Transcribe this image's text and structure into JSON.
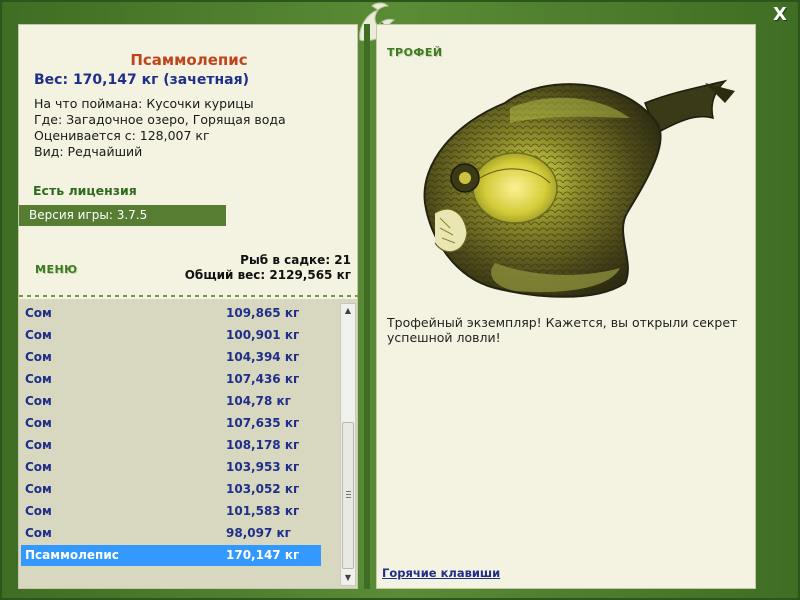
{
  "close_label": "X",
  "left": {
    "fish_name": "Псаммолепис",
    "weight": "Вес: 170,147 кг (зачетная)",
    "caught_on": "На что поймана: Кусочки курицы",
    "location": "Где: Загадочное озеро, Горящая вода",
    "valued_from": "Оценивается с: 128,007 кг",
    "kind": "Вид: Редчайший",
    "license": "Есть лицензия",
    "version": "Версия игры: 3.7.5",
    "menu_label": "МЕНЮ",
    "fish_in_keepnet": "Рыб в садке: 21",
    "total_weight": "Общий вес: 2129,565 кг"
  },
  "list": {
    "items": [
      {
        "name": "Сом",
        "weight": "109,865 кг"
      },
      {
        "name": "Сом",
        "weight": "100,901 кг"
      },
      {
        "name": "Сом",
        "weight": "104,394 кг"
      },
      {
        "name": "Сом",
        "weight": "107,436 кг"
      },
      {
        "name": "Сом",
        "weight": "104,78 кг"
      },
      {
        "name": "Сом",
        "weight": "107,635 кг"
      },
      {
        "name": "Сом",
        "weight": "108,178 кг"
      },
      {
        "name": "Сом",
        "weight": "103,953 кг"
      },
      {
        "name": "Сом",
        "weight": "103,052 кг"
      },
      {
        "name": "Сом",
        "weight": "101,583 кг"
      },
      {
        "name": "Сом",
        "weight": "98,097 кг"
      },
      {
        "name": "Псаммолепис",
        "weight": "170,147 кг"
      }
    ],
    "selected_index": 11
  },
  "right": {
    "trophy_label": "ТРОФЕЙ",
    "description": "Трофейный экземпляр! Кажется, вы открыли секрет успешной ловли!",
    "hotkeys": "Горячие клавиши"
  },
  "colors": {
    "frame_green": "#4a7a2c",
    "panel_bg": "#f4f3e2",
    "name_orange": "#c0441b",
    "text_blue": "#1f2f8a",
    "selected_blue": "#3399ff",
    "label_green": "#3d7a22"
  }
}
